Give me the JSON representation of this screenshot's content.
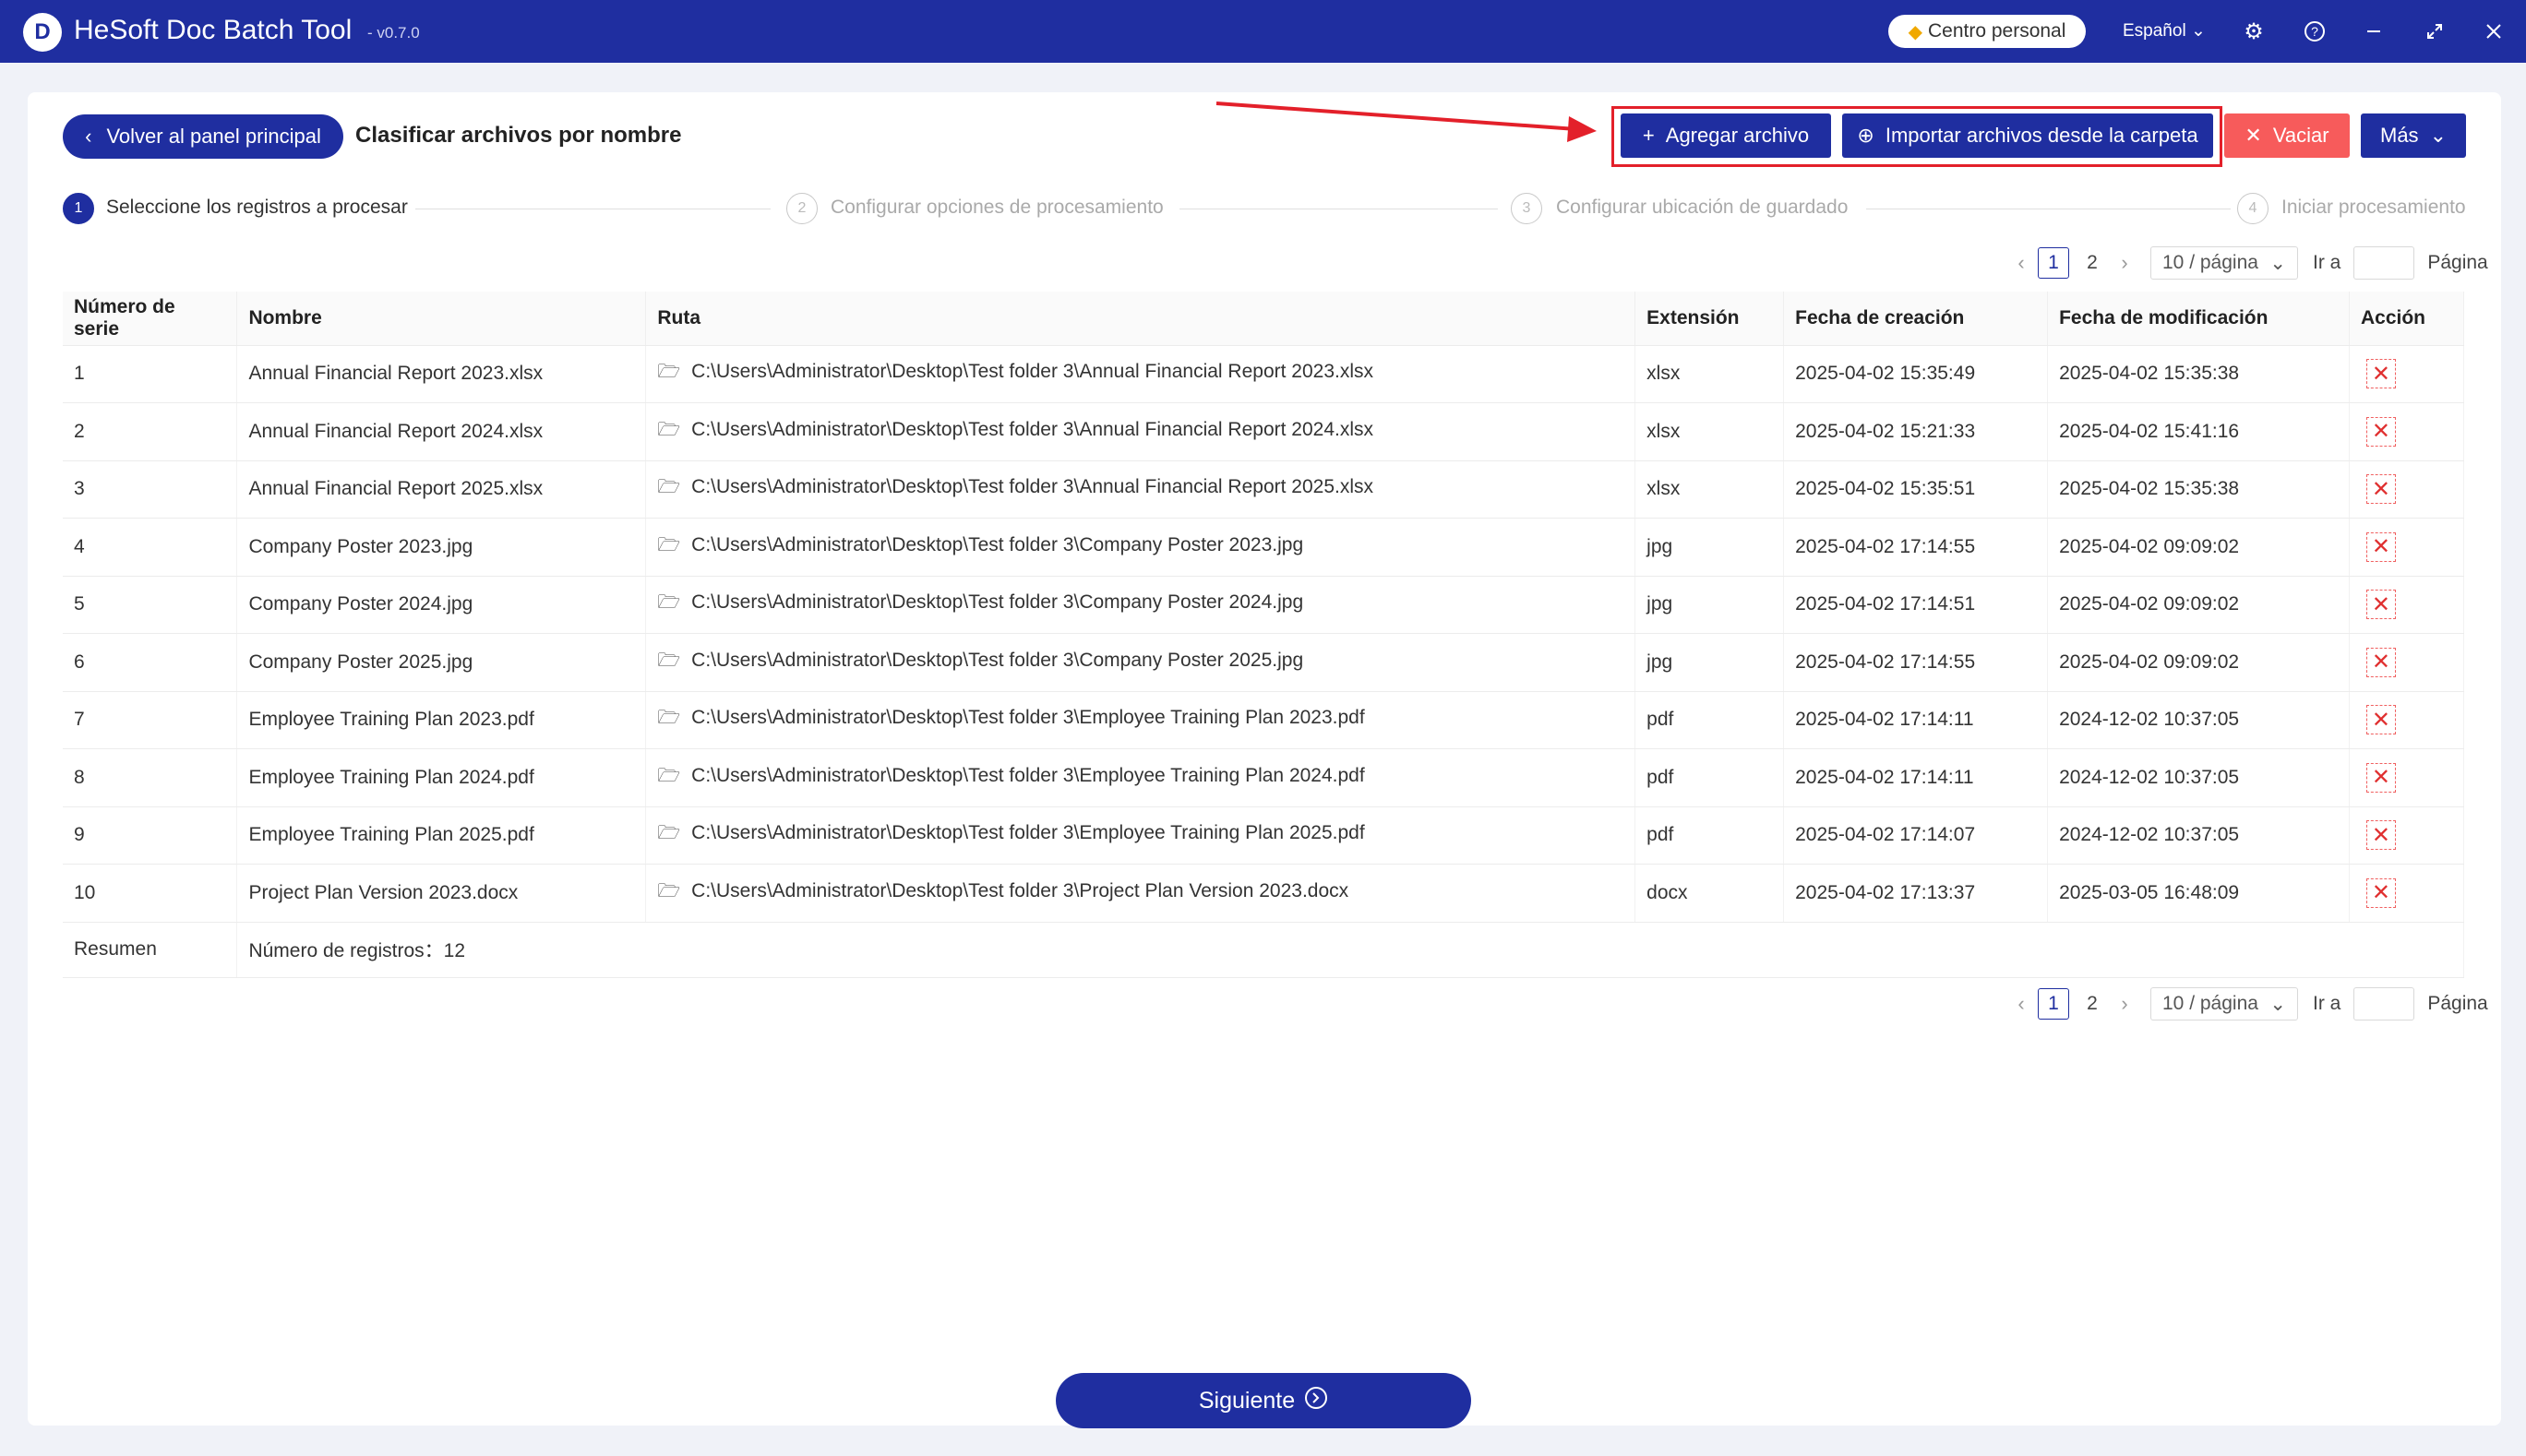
{
  "app": {
    "title": "HeSoft Doc Batch Tool",
    "version": "- v0.7.0",
    "logo_letter": "D",
    "personal_center": "Centro personal",
    "language": "Español"
  },
  "header": {
    "back_label": "Volver al panel principal",
    "page_title": "Clasificar archivos por nombre",
    "add_file": "Agregar archivo",
    "import_folder": "Importar archivos desde la carpeta",
    "clear": "Vaciar",
    "more": "Más"
  },
  "steps": [
    {
      "num": "1",
      "label": "Seleccione los registros a procesar"
    },
    {
      "num": "2",
      "label": "Configurar opciones de procesamiento"
    },
    {
      "num": "3",
      "label": "Configurar ubicación de guardado"
    },
    {
      "num": "4",
      "label": "Iniciar procesamiento"
    }
  ],
  "pager": {
    "pages": [
      "1",
      "2"
    ],
    "current": "1",
    "page_size": "10 / página",
    "goto_label": "Ir a",
    "page_word": "Página"
  },
  "table": {
    "columns": [
      "Número de serie",
      "Nombre",
      "Ruta",
      "Extensión",
      "Fecha de creación",
      "Fecha de modificación",
      "Acción"
    ],
    "rows": [
      {
        "num": "1",
        "name": "Annual Financial Report 2023.xlsx",
        "path": "C:\\Users\\Administrator\\Desktop\\Test folder 3\\Annual Financial Report 2023.xlsx",
        "ext": "xlsx",
        "created": "2025-04-02 15:35:49",
        "modified": "2025-04-02 15:35:38"
      },
      {
        "num": "2",
        "name": "Annual Financial Report 2024.xlsx",
        "path": "C:\\Users\\Administrator\\Desktop\\Test folder 3\\Annual Financial Report 2024.xlsx",
        "ext": "xlsx",
        "created": "2025-04-02 15:21:33",
        "modified": "2025-04-02 15:41:16"
      },
      {
        "num": "3",
        "name": "Annual Financial Report 2025.xlsx",
        "path": "C:\\Users\\Administrator\\Desktop\\Test folder 3\\Annual Financial Report 2025.xlsx",
        "ext": "xlsx",
        "created": "2025-04-02 15:35:51",
        "modified": "2025-04-02 15:35:38"
      },
      {
        "num": "4",
        "name": "Company Poster 2023.jpg",
        "path": "C:\\Users\\Administrator\\Desktop\\Test folder 3\\Company Poster 2023.jpg",
        "ext": "jpg",
        "created": "2025-04-02 17:14:55",
        "modified": "2025-04-02 09:09:02"
      },
      {
        "num": "5",
        "name": "Company Poster 2024.jpg",
        "path": "C:\\Users\\Administrator\\Desktop\\Test folder 3\\Company Poster 2024.jpg",
        "ext": "jpg",
        "created": "2025-04-02 17:14:51",
        "modified": "2025-04-02 09:09:02"
      },
      {
        "num": "6",
        "name": "Company Poster 2025.jpg",
        "path": "C:\\Users\\Administrator\\Desktop\\Test folder 3\\Company Poster 2025.jpg",
        "ext": "jpg",
        "created": "2025-04-02 17:14:55",
        "modified": "2025-04-02 09:09:02"
      },
      {
        "num": "7",
        "name": "Employee Training Plan 2023.pdf",
        "path": "C:\\Users\\Administrator\\Desktop\\Test folder 3\\Employee Training Plan 2023.pdf",
        "ext": "pdf",
        "created": "2025-04-02 17:14:11",
        "modified": "2024-12-02 10:37:05"
      },
      {
        "num": "8",
        "name": "Employee Training Plan 2024.pdf",
        "path": "C:\\Users\\Administrator\\Desktop\\Test folder 3\\Employee Training Plan 2024.pdf",
        "ext": "pdf",
        "created": "2025-04-02 17:14:11",
        "modified": "2024-12-02 10:37:05"
      },
      {
        "num": "9",
        "name": "Employee Training Plan 2025.pdf",
        "path": "C:\\Users\\Administrator\\Desktop\\Test folder 3\\Employee Training Plan 2025.pdf",
        "ext": "pdf",
        "created": "2025-04-02 17:14:07",
        "modified": "2024-12-02 10:37:05"
      },
      {
        "num": "10",
        "name": "Project Plan Version 2023.docx",
        "path": "C:\\Users\\Administrator\\Desktop\\Test folder 3\\Project Plan Version 2023.docx",
        "ext": "docx",
        "created": "2025-04-02 17:13:37",
        "modified": "2025-03-05 16:48:09"
      }
    ],
    "summary_label": "Resumen",
    "summary_value": "Número de registros：12"
  },
  "footer": {
    "next_label": "Siguiente"
  },
  "icons": {
    "folder": "folder-icon",
    "delete": "close-icon",
    "settings": "gear-icon",
    "help": "question-icon",
    "minimize": "minimize-icon",
    "maximize": "maximize-icon",
    "close": "close-icon"
  },
  "colors": {
    "primary": "#1f2ea0",
    "danger": "#f75b5b",
    "highlight": "#e3202a"
  }
}
